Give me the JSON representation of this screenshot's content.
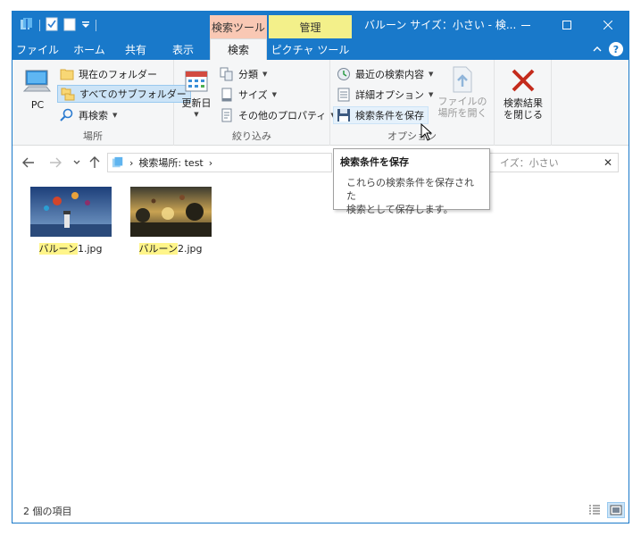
{
  "window": {
    "title": "バルーン サイズ：小さい - 検...",
    "caption": {
      "minimize": "—",
      "maximize": "☐",
      "close": "✕"
    }
  },
  "context_tabs": {
    "search_tools": "検索ツール",
    "manage": "管理"
  },
  "tabs": [
    {
      "label": "ファイル"
    },
    {
      "label": "ホーム"
    },
    {
      "label": "共有"
    },
    {
      "label": "表示"
    },
    {
      "label": "検索"
    },
    {
      "label": "ピクチャ ツール"
    }
  ],
  "ribbon": {
    "location": {
      "label": "場所",
      "pc": "PC",
      "current_folder": "現在のフォルダー",
      "all_subfolders": "すべてのサブフォルダー",
      "search_again": "再検索"
    },
    "refine": {
      "label": "絞り込み",
      "date_modified": "更新日",
      "kind": "分類",
      "size": "サイズ",
      "other_properties": "その他のプロパティ"
    },
    "options": {
      "label": "オプション",
      "recent_searches": "最近の検索内容",
      "advanced_options": "詳細オプション",
      "save_search": "検索条件を保存",
      "open_file_location_1": "ファイルの",
      "open_file_location_2": "場所を開く"
    },
    "close": {
      "close_search_1": "検索結果",
      "close_search_2": "を閉じる"
    }
  },
  "address": {
    "path": "検索場所: test",
    "search_placeholder": "イズ：小さい"
  },
  "tooltip": {
    "title": "検索条件を保存",
    "body_line1": "これらの検索条件を保存された",
    "body_line2": "検索として保存します。"
  },
  "files": [
    {
      "highlight": "バルーン",
      "rest": "1.jpg"
    },
    {
      "highlight": "バルーン",
      "rest": "2.jpg"
    }
  ],
  "status": {
    "item_count": "2 個の項目"
  },
  "colors": {
    "accent": "#1979ca",
    "search_tab": "#f9c8b4",
    "manage_tab": "#f3f08a",
    "match_highlight": "#fff58a",
    "close_x": "#c42b1c"
  }
}
